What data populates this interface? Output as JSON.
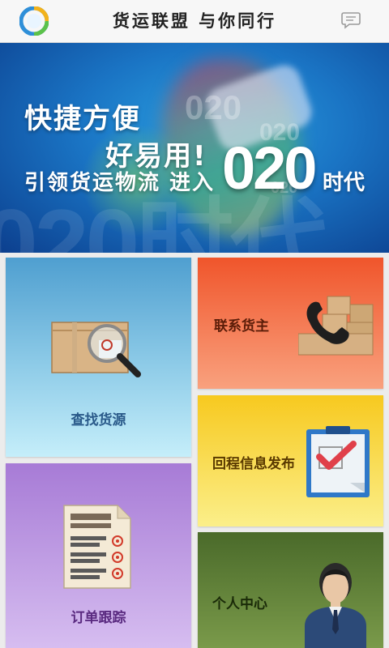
{
  "header": {
    "title": "货运联盟  与你同行",
    "logo_icon": "app-logo-icon",
    "message_icon": "chat-bubble-icon"
  },
  "banner": {
    "line1": "快捷方便",
    "line2": "好易用!",
    "line3": "引领货运物流  进入",
    "big": "020",
    "era": "时代"
  },
  "tiles": {
    "find_cargo": "查找货源",
    "contact_owner": "联系货主",
    "return_info": "回程信息发布",
    "order_tracking": "订单跟踪",
    "personal_center": "个人中心"
  },
  "colors": {
    "find": "#6fb6de",
    "contact": "#f47a52",
    "return": "#f9d84a",
    "order": "#bd9de4",
    "personal": "#5e7e36"
  }
}
